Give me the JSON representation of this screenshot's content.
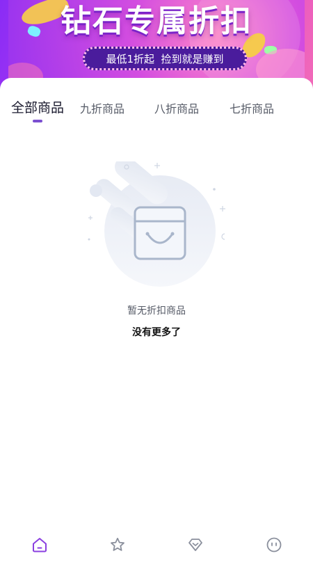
{
  "banner": {
    "title": "钻石专属折扣",
    "subtitle": "最低1折起  捡到就是赚到"
  },
  "tabs": [
    {
      "label": "全部商品",
      "active": true
    },
    {
      "label": "九折商品",
      "active": false
    },
    {
      "label": "八折商品",
      "active": false
    },
    {
      "label": "七折商品",
      "active": false
    }
  ],
  "empty_state": {
    "icon": "shopping-bag-icon",
    "message": "暂无折扣商品",
    "no_more": "没有更多了"
  },
  "bottom_nav": [
    {
      "icon": "home-icon",
      "active": true
    },
    {
      "icon": "star-icon",
      "active": false
    },
    {
      "icon": "diamond-icon",
      "active": false
    },
    {
      "icon": "profile-face-icon",
      "active": false
    }
  ],
  "colors": {
    "accent": "#7b4fd0",
    "banner_start": "#8a2cf5",
    "banner_end": "#f26bb8",
    "pill": "#4a1c9c",
    "text_primary": "#1a1a2e",
    "text_secondary": "#555a66"
  }
}
